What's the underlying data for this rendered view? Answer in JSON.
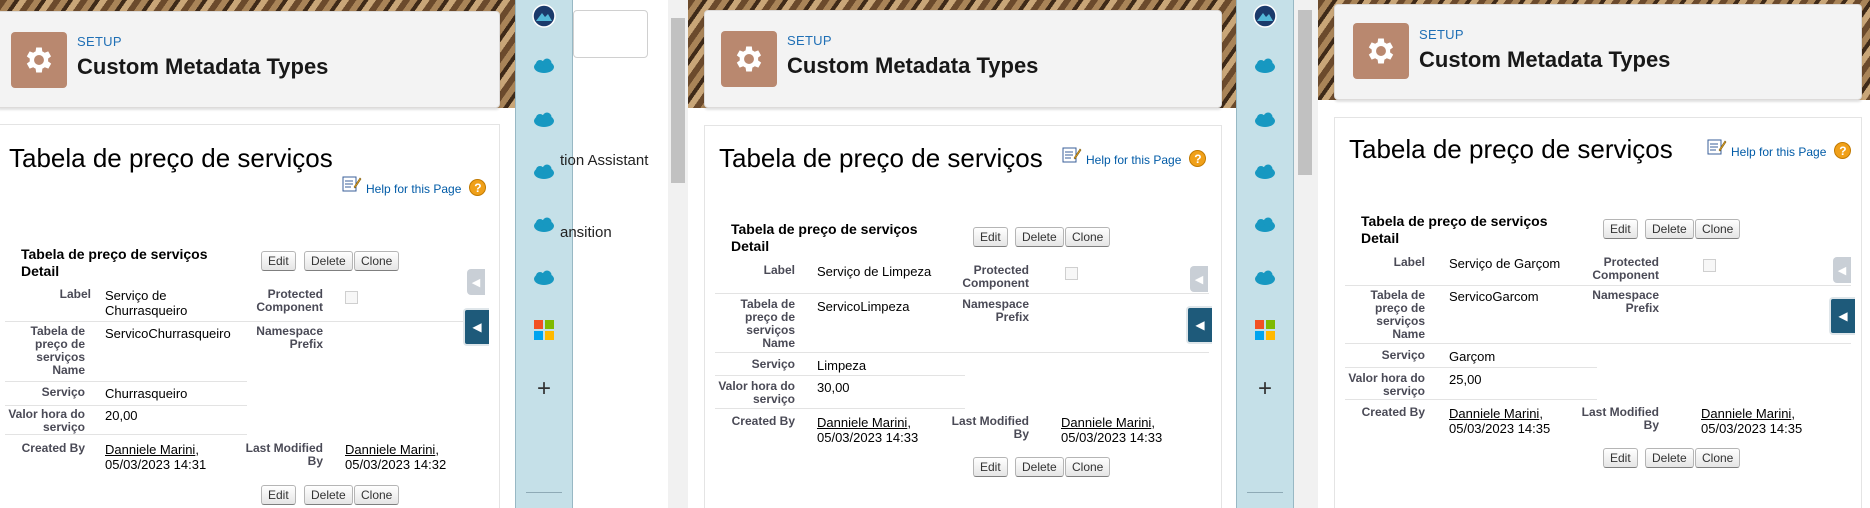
{
  "header": {
    "eyebrow": "SETUP",
    "title": "Custom Metadata Types"
  },
  "page_title": "Tabela de preço de serviços",
  "help_link": "Help for this Page",
  "help_icon": "?",
  "buttons": {
    "edit": "Edit",
    "delete": "Delete",
    "clone": "Clone"
  },
  "detail_title": "Tabela de preço de serviços Detail",
  "field_labels": {
    "label": "Label",
    "protected": "Protected Component",
    "name": "Tabela de preço de serviços Name",
    "namespace": "Namespace Prefix",
    "servico": "Serviço",
    "valor": "Valor hora do serviço",
    "created_by": "Created By",
    "last_modified": "Last Modified By"
  },
  "records": [
    {
      "label": "Serviço de Churrasqueiro",
      "name": "ServicoChurrasqueiro",
      "servico": "Churrasqueiro",
      "valor": "20,00",
      "created_by": "Danniele Marini",
      "created_date": "05/03/2023 14:31",
      "modified_by": "Danniele Marini",
      "modified_date": "05/03/2023 14:32"
    },
    {
      "label": "Serviço de Limpeza",
      "name": "ServicoLimpeza",
      "servico": "Limpeza",
      "valor": "30,00",
      "created_by": "Danniele Marini",
      "created_date": "05/03/2023 14:33",
      "modified_by": "Danniele Marini",
      "modified_date": "05/03/2023 14:33"
    },
    {
      "label": "Serviço de Garçom",
      "name": "ServicoGarcom",
      "servico": "Garçom",
      "valor": "25,00",
      "created_by": "Danniele Marini",
      "created_date": "05/03/2023 14:35",
      "modified_by": "Danniele Marini",
      "modified_date": "05/03/2023 14:35"
    }
  ],
  "sidebar_fragments": [
    "tion Assistant",
    "ansition"
  ],
  "utility_bar_icons": [
    "trailhead-icon",
    "salesforce-cloud-icon",
    "salesforce-cloud-icon",
    "salesforce-cloud-icon",
    "salesforce-cloud-icon",
    "salesforce-cloud-icon",
    "microsoft-icon",
    "plus-icon"
  ],
  "colors": {
    "header_icon_bg": "#b9886f",
    "eyebrow": "#1f6fb5",
    "utility_bar_bg": "#c5e0e8",
    "collapse_tab": "#1e5a7a",
    "cloud": "#1798c1",
    "help_icon": "#f0a019"
  }
}
